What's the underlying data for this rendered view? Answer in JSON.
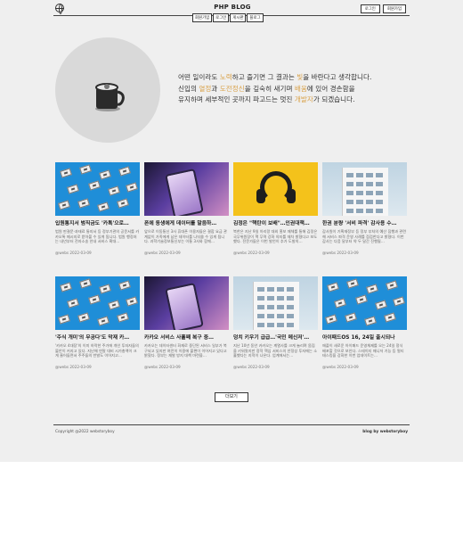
{
  "header": {
    "brand": "PHP BLOG",
    "auth": [
      "로그인",
      "회원가입"
    ],
    "nav": [
      "회원가입",
      "로그인",
      "게시판",
      "블로그"
    ]
  },
  "hero": {
    "line1_a": "어떤 일이라도 ",
    "line1_b": "노력",
    "line1_c": "하고 즐기면 그 결과는 ",
    "line1_d": "빛",
    "line1_e": "을 바란다고 생각합니다.",
    "line2_a": "신입의 ",
    "line2_b": "열정",
    "line2_c": "과 ",
    "line2_d": "도전정신",
    "line2_e": "을 깊숙히 새기며 ",
    "line2_f": "배움",
    "line2_g": "에 있어 경손함을",
    "line3_a": "유지하며 세부적인 곳까지 파고드는 멋진 ",
    "line3_b": "개발자",
    "line3_c": "가 되겠습니다."
  },
  "posts_row1": [
    {
      "title": "입원통지서 범직금도 '카톡'으로…",
      "excerpt": "법원 판결문·과태료 통지서 등 정부기관의 공문서를 카카오톡 메시지로 받아볼 수 있게 됩니다. 법원 행정처는 내년부터 전자소송 안내 서비스 확대…",
      "meta": "@webs 2022-03-09"
    },
    {
      "title": "폰에 동생에게 데이터를 말음하…",
      "excerpt": "앞으로 이동통신 3사 휴대폰 이용자들은 결합 요금 관계없이 가족에게 남은 데이터를 나눠쓸 수 있게 됩니다. 과학기술정보통신부는 이통 3사와 함께…",
      "meta": "@webs 2022-03-09"
    },
    {
      "title": "김정은 \"핵탄이 보배\"…인권대책…",
      "excerpt": "북한은 지난 9일 아리랑 대외 홍보 매체를 통해 김정은 국무위원장이 핵 무력 강화 의지를 재차 밝혔다고 보도했다. 전문가들은 이번 발언이 추가 도발의…",
      "meta": "@webs 2022-03-09"
    },
    {
      "title": "한권 분량 '서비 파격' 감사용 수…",
      "excerpt": "감사원이 기획재정부 등 정부 부처의 예산 집행과 관련해 서비스 파격 운영 사례를 점검한다고 밝혔다. 이번 감사는 다음 달부터 약 두 달간 진행될…",
      "meta": "@webs 2022-03-09"
    }
  ],
  "posts_row2": [
    {
      "title": "'주식 개미'의 무공다'도 막재 카…",
      "excerpt": "'카카오 4대장'의 이미 하락한 주가에 개인 투자자들의 불안이 커지고 있다. 지난해 연말 대비 시가총액이 크게 줄어들면서 주주들의 반발도 이어지고…",
      "meta": "@webs 2022-03-09"
    },
    {
      "title": "카카오 서비스 사흘째 복구 중…",
      "excerpt": "카카오는 데이터센터 화재로 중단된 서비스 일부가 복구되고 있지만 여전히 이용에 불편이 이어지고 있다고 밝혔다. 정부는 재발 방지 대책 마련을…",
      "meta": "@webs 2022-03-09"
    },
    {
      "title": "덩치 키우기 급급…'국민 메신저'…",
      "excerpt": "지난 10년 동안 카카오는 계열사를 크게 늘리며 몸집을 키워왔지만 정작 핵심 서비스의 안정성 투자에는 소홀했다는 지적이 나온다. 업계에서는…",
      "meta": "@webs 2022-03-09"
    },
    {
      "title": "아이패드OS 16, 24일 출시되나",
      "excerpt": "애플이 새로운 아이패드 운영체제를 오는 24일 정식 배포할 것으로 보인다. 스테이지 매니저 기능 등 멀티태스킹을 강화한 이번 업데이트는…",
      "meta": "@webs 2022-03-09"
    }
  ],
  "more_label": "더보기",
  "footer": {
    "copyright": "Copyright @2022 webstoryboy",
    "credit": "blog by webstoryboy"
  },
  "icons": {
    "logo": "globe-icon",
    "hero": "coffee-mug-icon"
  }
}
